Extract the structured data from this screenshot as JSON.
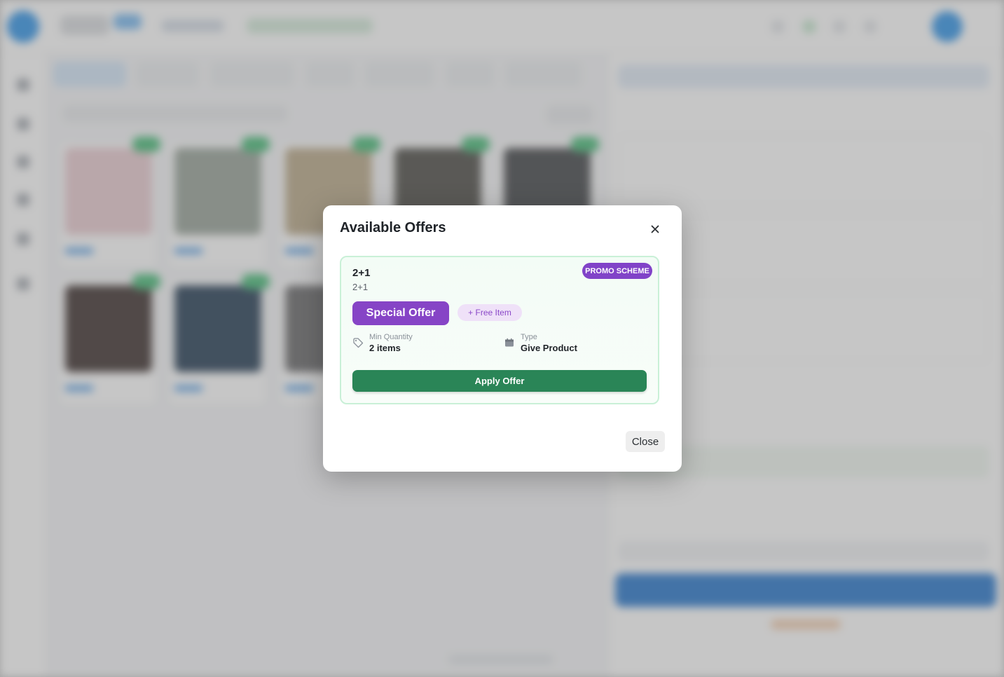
{
  "modal": {
    "title": "Available Offers",
    "close_label": "Close"
  },
  "offer": {
    "name": "2+1",
    "subtitle": "2+1",
    "badge": "PROMO SCHEME",
    "special_label": "Special Offer",
    "free_item_label": "+ Free Item",
    "min_quantity_label": "Min Quantity",
    "min_quantity_value": "2 items",
    "type_label": "Type",
    "type_value": "Give Product",
    "apply_label": "Apply Offer"
  },
  "colors": {
    "accent_purple": "#8644c6",
    "apply_green": "#2a8557",
    "card_border": "#c9f0d7",
    "brand_blue": "#1d8ae6"
  }
}
